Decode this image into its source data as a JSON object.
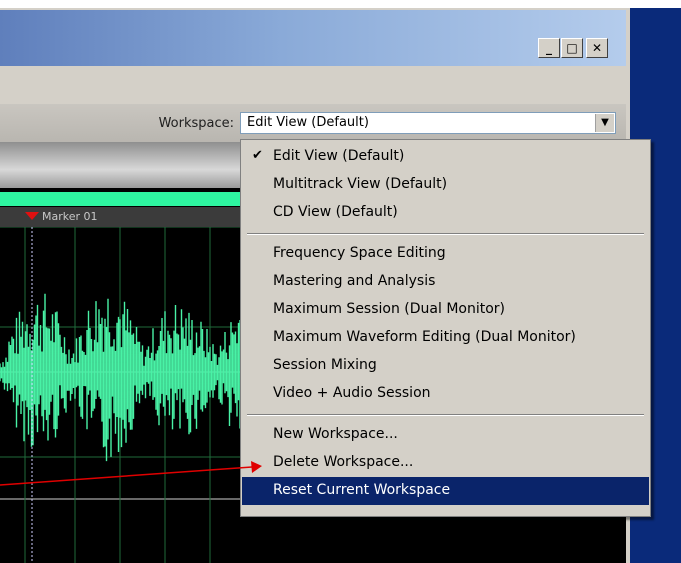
{
  "window": {
    "buttons": {
      "minimize": "_",
      "maximize": "□",
      "close": "✕"
    }
  },
  "toolbar": {
    "workspace_label": "Workspace:",
    "workspace_value": "Edit View (Default)",
    "dropdown_arrow": "▼"
  },
  "editor": {
    "marker_label": "Marker 01",
    "waveform_color": "#49f2a6"
  },
  "menu": {
    "group1": [
      {
        "label": "Edit View (Default)",
        "checked": true
      },
      {
        "label": "Multitrack View (Default)"
      },
      {
        "label": "CD View (Default)"
      }
    ],
    "group2": [
      {
        "label": "Frequency Space Editing"
      },
      {
        "label": "Mastering and Analysis"
      },
      {
        "label": "Maximum Session (Dual Monitor)"
      },
      {
        "label": "Maximum Waveform Editing (Dual Monitor)"
      },
      {
        "label": "Session Mixing"
      },
      {
        "label": "Video + Audio Session"
      }
    ],
    "group3": [
      {
        "label": "New Workspace..."
      },
      {
        "label": "Delete Workspace..."
      },
      {
        "label": "Reset Current Workspace",
        "highlighted": true
      }
    ],
    "check_glyph": "✔"
  },
  "colors": {
    "selection": "#0a246a",
    "marker": "#e01010",
    "annotation_arrow": "#e00000",
    "green_bar": "#2ef5a0"
  }
}
